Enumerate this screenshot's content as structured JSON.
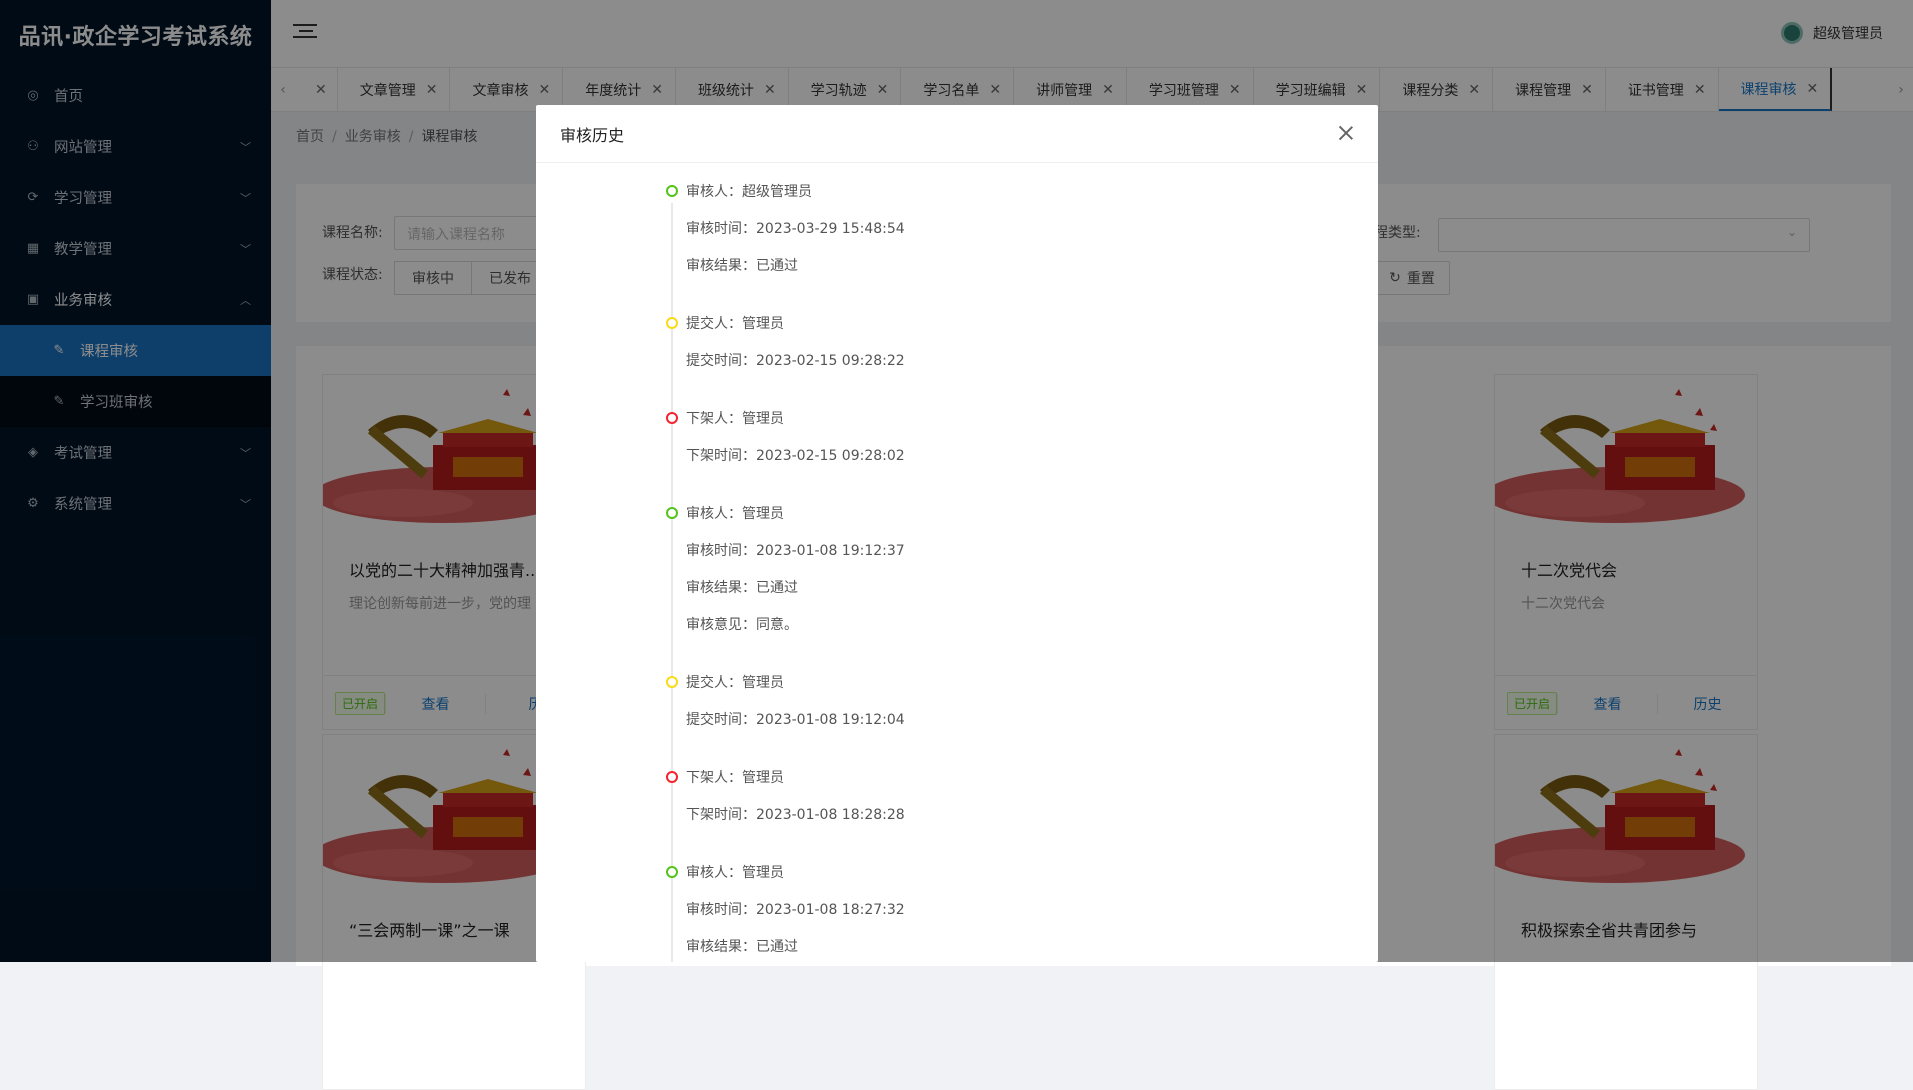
{
  "app": {
    "title": "品讯·政企学习考试系统"
  },
  "user": {
    "name": "超级管理员"
  },
  "sidebar": {
    "items": [
      {
        "label": "首页",
        "icon": "dashboard-icon",
        "glyph": "◎",
        "has_arrow": false
      },
      {
        "label": "网站管理",
        "icon": "sitemap-icon",
        "glyph": "⚇",
        "has_arrow": true
      },
      {
        "label": "学习管理",
        "icon": "study-icon",
        "glyph": "⟳",
        "has_arrow": true
      },
      {
        "label": "教学管理",
        "icon": "grid-icon",
        "glyph": "▦",
        "has_arrow": true
      },
      {
        "label": "业务审核",
        "icon": "calendar-icon",
        "glyph": "▣",
        "has_arrow": true,
        "open": true
      },
      {
        "label": "考试管理",
        "icon": "layers-icon",
        "glyph": "◈",
        "has_arrow": true
      },
      {
        "label": "系统管理",
        "icon": "gear-icon",
        "glyph": "⚙",
        "has_arrow": true
      }
    ],
    "sub_items": [
      {
        "label": "课程审核",
        "active": true
      },
      {
        "label": "学习班审核",
        "active": false
      }
    ]
  },
  "tabs": [
    {
      "label": "",
      "empty": true
    },
    {
      "label": "文章管理"
    },
    {
      "label": "文章审核"
    },
    {
      "label": "年度统计"
    },
    {
      "label": "班级统计"
    },
    {
      "label": "学习轨迹"
    },
    {
      "label": "学习名单"
    },
    {
      "label": "讲师管理"
    },
    {
      "label": "学习班管理"
    },
    {
      "label": "学习班编辑"
    },
    {
      "label": "课程分类"
    },
    {
      "label": "课程管理"
    },
    {
      "label": "证书管理"
    },
    {
      "label": "课程审核",
      "active": true
    }
  ],
  "breadcrumb": {
    "home": "首页",
    "section": "业务审核",
    "current": "课程审核"
  },
  "search": {
    "course_name_label": "课程名称:",
    "course_name_placeholder": "请输入课程名称",
    "course_type_label": "程类型:",
    "course_status_label": "课程状态:",
    "status_options": [
      "审核中",
      "已发布"
    ],
    "reset_label": "重置"
  },
  "cards": [
    {
      "title": "以党的二十大精神加强青...",
      "desc": "理论创新每前进一步，党的理",
      "status": "已开启",
      "view": "查看",
      "history": "历"
    },
    {
      "title": "十二次党代会",
      "desc": "十二次党代会",
      "status": "已开启",
      "view": "查看",
      "history": "历史"
    },
    {
      "title": "“三会两制一课”之一课",
      "desc": "",
      "status": "",
      "view": "",
      "history": ""
    },
    {
      "title": "积极探索全省共青团参与",
      "desc": "",
      "status": "",
      "view": "",
      "history": ""
    }
  ],
  "modal": {
    "title": "审核历史",
    "timeline": [
      {
        "color": "#52c41a",
        "lines": [
          "审核人：超级管理员",
          "审核时间：2023-03-29 15:48:54",
          "审核结果：已通过"
        ]
      },
      {
        "color": "#fadb14",
        "lines": [
          "提交人：管理员",
          "提交时间：2023-02-15 09:28:22"
        ]
      },
      {
        "color": "#f5222d",
        "lines": [
          "下架人：管理员",
          "下架时间：2023-02-15 09:28:02"
        ]
      },
      {
        "color": "#52c41a",
        "lines": [
          "审核人：管理员",
          "审核时间：2023-01-08 19:12:37",
          "审核结果：已通过",
          "审核意见：同意。"
        ]
      },
      {
        "color": "#fadb14",
        "lines": [
          "提交人：管理员",
          "提交时间：2023-01-08 19:12:04"
        ]
      },
      {
        "color": "#f5222d",
        "lines": [
          "下架人：管理员",
          "下架时间：2023-01-08 18:28:28"
        ]
      },
      {
        "color": "#52c41a",
        "lines": [
          "审核人：管理员",
          "审核时间：2023-01-08 18:27:32",
          "审核结果：已通过"
        ]
      }
    ]
  }
}
